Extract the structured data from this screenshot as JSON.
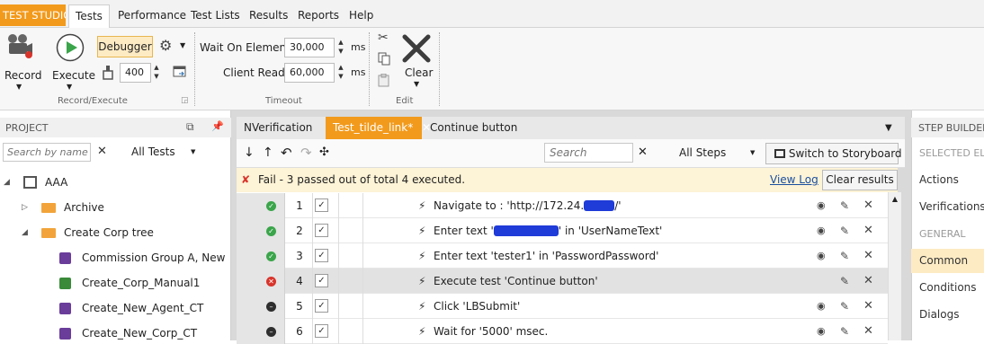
{
  "brand": "TEST STUDIO",
  "menu": [
    "Tests",
    "Performance",
    "Test Lists",
    "Results",
    "Reports",
    "Help"
  ],
  "ribbon": {
    "record_label": "Record",
    "execute_label": "Execute",
    "debugger_label": "Debugger",
    "speed_value": "400",
    "group_record_execute": "Record/Execute",
    "wait_on_elements_label": "Wait On Elements",
    "wait_on_elements_value": "30,000",
    "client_ready_label": "Client Ready",
    "client_ready_value": "60,000",
    "ms_unit": "ms",
    "group_timeout": "Timeout",
    "clear_label": "Clear",
    "group_edit": "Edit"
  },
  "project": {
    "title": "PROJECT",
    "search_placeholder": "Search by name",
    "filter": "All Tests",
    "tree": [
      {
        "label": "AAA",
        "kind": "root"
      },
      {
        "label": "Archive",
        "kind": "folder"
      },
      {
        "label": "Create Corp tree",
        "kind": "folder"
      },
      {
        "label": "Commission Group A, New Sup",
        "kind": "test"
      },
      {
        "label": "Create_Corp_Manual1",
        "kind": "test"
      },
      {
        "label": "Create_New_Agent_CT",
        "kind": "test"
      },
      {
        "label": "Create_New_Corp_CT",
        "kind": "test"
      }
    ]
  },
  "tabs": [
    "NVerification",
    "Test_tilde_link*",
    "Continue button"
  ],
  "steps_toolbar": {
    "search_placeholder": "Search",
    "filter": "All Steps",
    "switch_label": "Switch to Storyboard"
  },
  "result": {
    "message": "Fail - 3 passed out of total 4 executed.",
    "view_log": "View Log",
    "clear_results": "Clear results"
  },
  "steps": [
    {
      "num": "1",
      "status": "pass",
      "text_a": "Navigate to : 'http://172.24.",
      "text_b": "/'"
    },
    {
      "num": "2",
      "status": "pass",
      "text_a": "Enter text '",
      "text_b": "' in 'UserNameText'"
    },
    {
      "num": "3",
      "status": "pass",
      "text_a": "Enter text 'tester1' in 'PasswordPassword'",
      "text_b": ""
    },
    {
      "num": "4",
      "status": "fail",
      "text_a": "Execute test 'Continue button'",
      "text_b": ""
    },
    {
      "num": "5",
      "status": "none",
      "text_a": "Click 'LBSubmit'",
      "text_b": ""
    },
    {
      "num": "6",
      "status": "none",
      "text_a": "Wait for '5000' msec.",
      "text_b": ""
    }
  ],
  "step_builder": {
    "title": "STEP BUILDER",
    "selected_header": "SELECTED ELE",
    "items1": [
      "Actions",
      "Verifications"
    ],
    "general_header": "GENERAL",
    "items2": [
      "Common",
      "Conditions",
      "Dialogs"
    ]
  },
  "colors": {
    "accent": "#f29a1c",
    "pass": "#3aa54a",
    "fail": "#d8342b",
    "redaction": "#1f3bd8"
  }
}
